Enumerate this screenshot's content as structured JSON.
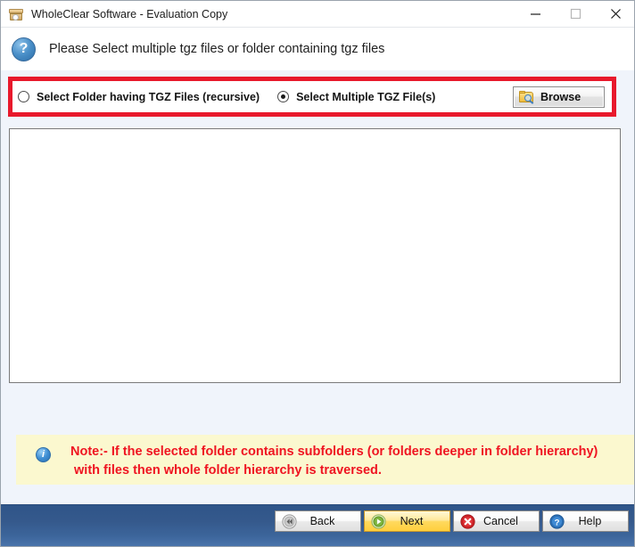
{
  "window": {
    "title": "WholeClear Software - Evaluation Copy",
    "title_icon": "archive-box-icon",
    "controls": {
      "minimize": "minimize-icon",
      "maximize": "maximize-icon",
      "close": "close-icon"
    }
  },
  "header": {
    "icon": "question-mark-icon",
    "icon_glyph": "?",
    "prompt": "Please Select multiple tgz files or folder containing tgz files"
  },
  "options": {
    "folder_option": {
      "label": "Select Folder having TGZ Files (recursive)",
      "checked": false
    },
    "files_option": {
      "label": "Select Multiple TGZ File(s)",
      "checked": true
    },
    "browse_button": {
      "label": "Browse",
      "icon": "folder-search-icon"
    }
  },
  "file_list": {
    "items": []
  },
  "note": {
    "icon": "info-icon",
    "icon_glyph": "i",
    "text": "Note:- If the selected folder contains subfolders (or folders deeper in folder hierarchy)\n with files then whole folder hierarchy is traversed."
  },
  "footer": {
    "buttons": [
      {
        "label": "Back",
        "icon": "rewind-icon",
        "state": "normal"
      },
      {
        "label": "Next",
        "icon": "play-icon",
        "state": "highlighted"
      },
      {
        "label": "Cancel",
        "icon": "cancel-icon",
        "state": "normal"
      },
      {
        "label": "Help",
        "icon": "help-icon",
        "state": "normal"
      }
    ]
  },
  "colors": {
    "annotation_red": "#e8192c",
    "note_text_red": "#ef1421",
    "note_bg": "#fbf8cf",
    "footer_blue": "#35598c",
    "accent_yellow": "#ffd95e"
  }
}
